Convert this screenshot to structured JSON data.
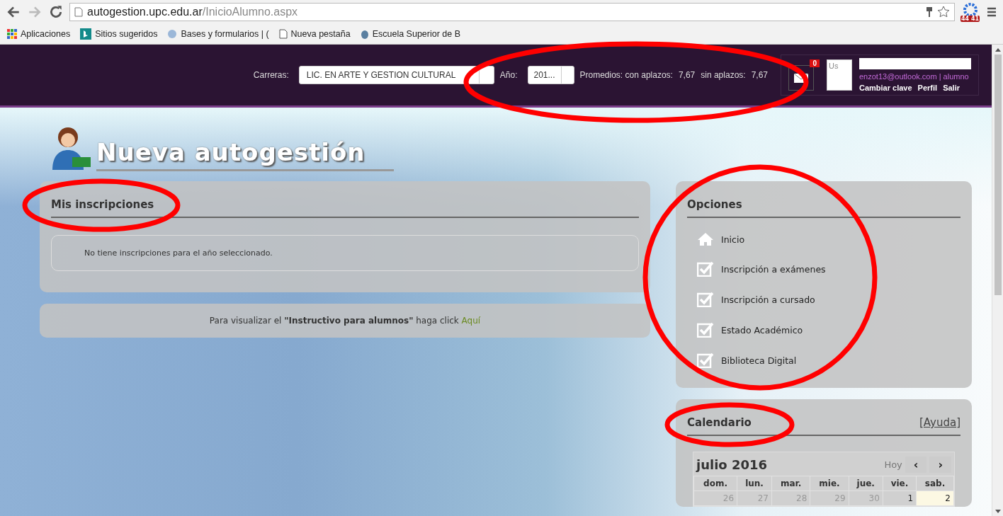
{
  "browser": {
    "url_host": "autogestion.upc.edu.ar",
    "url_path": "/InicioAlumno.aspx",
    "extension_badge": "44 41",
    "bookmarks": [
      {
        "label": "Aplicaciones",
        "kind": "apps"
      },
      {
        "label": "Sitios sugeridos",
        "kind": "bing"
      },
      {
        "label": "Bases y formularios | (",
        "kind": "globe"
      },
      {
        "label": "Nueva pestaña",
        "kind": "page"
      },
      {
        "label": "Escuela Superior de B",
        "kind": "shield"
      }
    ]
  },
  "header": {
    "careers_label": "Carreras:",
    "career": "LIC. EN ARTE Y GESTION CULTURAL",
    "year_label": "Año:",
    "year": "201...",
    "averages_label": "Promedios: con aplazos:",
    "with_value": "7,67",
    "without_label": "sin aplazos:",
    "without_value": "7,67",
    "mail_count": "0",
    "avatar_alt": "Us",
    "email": "enzot13@outlook.com",
    "separator": "|",
    "role": "alumno",
    "links": [
      "Cambiar clave",
      "Perfil",
      "Salir"
    ]
  },
  "site_title": "Nueva autogestión",
  "inscriptions": {
    "title": "Mis inscripciones",
    "message": "No tiene inscripciones para el año seleccionado."
  },
  "guide": {
    "text": "Para visualizar el **\"Instructivo para alumnos\"** haga click",
    "link": "Aquí"
  },
  "options": {
    "title": "Opciones",
    "items": [
      {
        "label": "Inicio",
        "kind": "home"
      },
      {
        "label": "Inscripción a exámenes",
        "kind": "check"
      },
      {
        "label": "Inscripción a cursado",
        "kind": "check"
      },
      {
        "label": "Estado Académico",
        "kind": "check"
      },
      {
        "label": "Biblioteca Digital",
        "kind": "check"
      }
    ]
  },
  "calendar": {
    "title": "Calendario",
    "help": "[Ayuda]",
    "month": "julio 2016",
    "today_button": "Hoy",
    "prev": "‹",
    "next": "›",
    "weekdays": [
      "dom.",
      "lun.",
      "mar.",
      "mie.",
      "jue.",
      "vie.",
      "sab."
    ],
    "days": [
      {
        "label": "26",
        "other_month": true,
        "today": false
      },
      {
        "label": "27",
        "other_month": true,
        "today": false
      },
      {
        "label": "28",
        "other_month": true,
        "today": false
      },
      {
        "label": "29",
        "other_month": true,
        "today": false
      },
      {
        "label": "30",
        "other_month": true,
        "today": false
      },
      {
        "label": "1",
        "other_month": false,
        "today": false
      },
      {
        "label": "2",
        "other_month": false,
        "today": true
      }
    ]
  }
}
